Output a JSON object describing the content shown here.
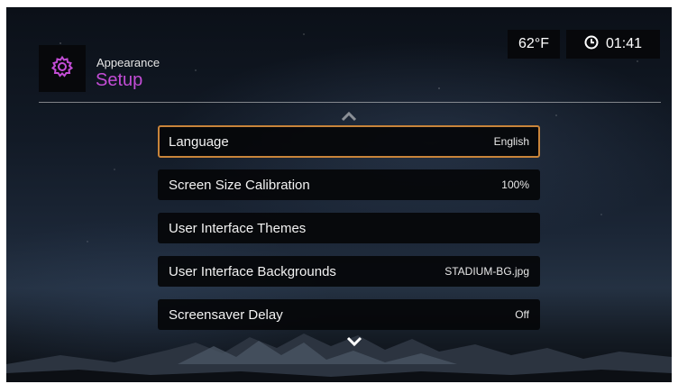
{
  "header": {
    "subtitle": "Appearance",
    "title": "Setup",
    "icon": "gear-icon"
  },
  "status": {
    "temperature": "62°F",
    "time": "01:41",
    "clock_icon": "clock-icon"
  },
  "menu": {
    "items": [
      {
        "label": "Language",
        "value": "English",
        "selected": true
      },
      {
        "label": "Screen Size Calibration",
        "value": "100%",
        "selected": false
      },
      {
        "label": "User Interface Themes",
        "value": "",
        "selected": false
      },
      {
        "label": "User Interface Backgrounds",
        "value": "STADIUM-BG.jpg",
        "selected": false
      },
      {
        "label": "Screensaver Delay",
        "value": "Off",
        "selected": false
      }
    ]
  },
  "colors": {
    "accent": "#c34dd6",
    "selection_border": "#c8843a"
  }
}
